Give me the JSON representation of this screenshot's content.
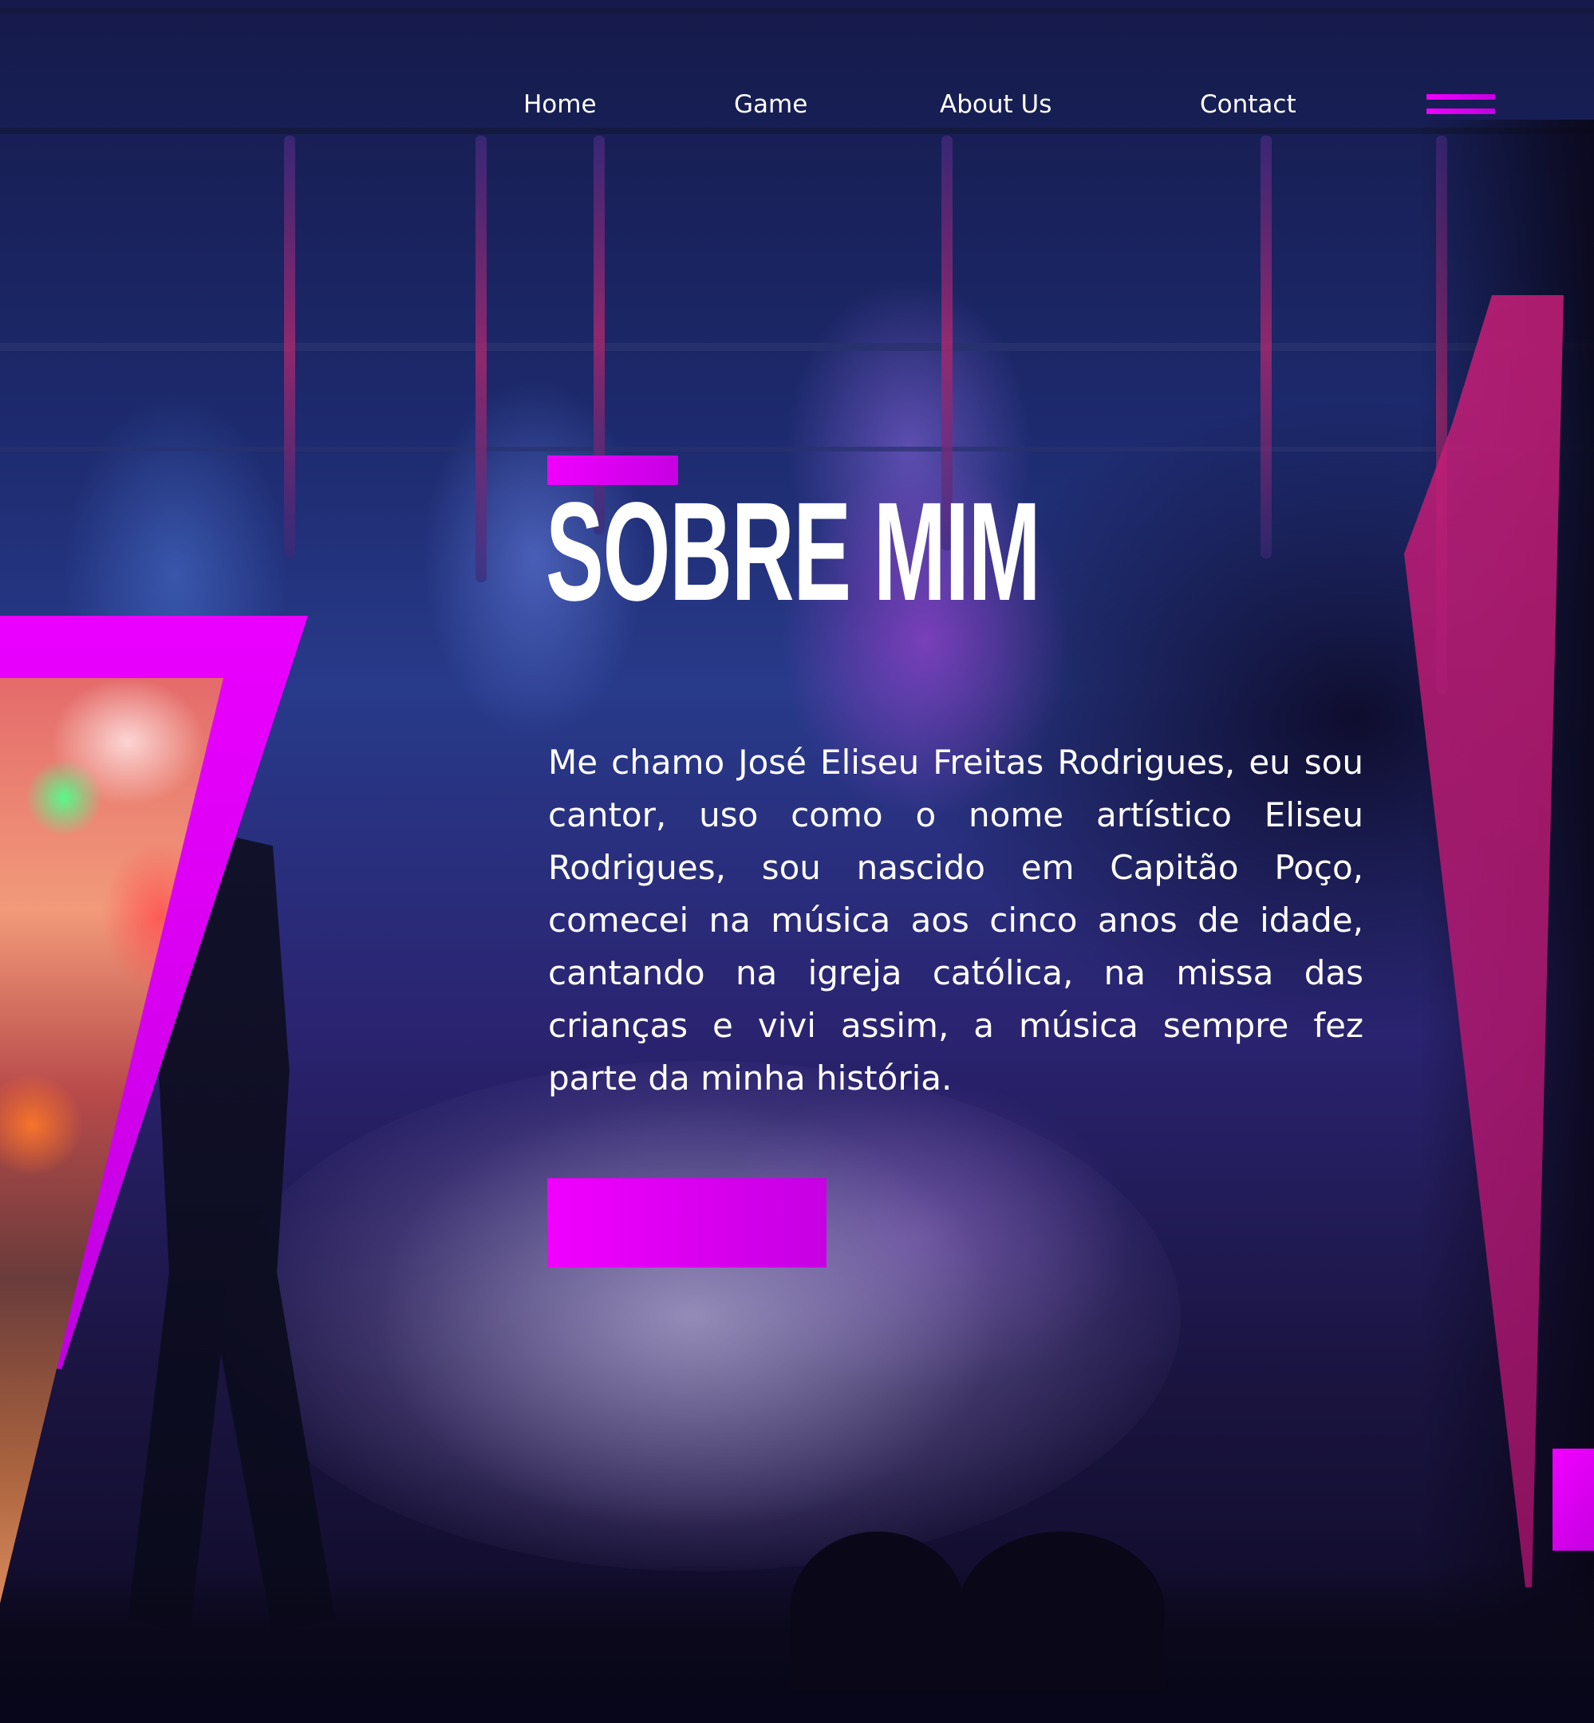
{
  "nav": {
    "items": [
      {
        "label": "Home"
      },
      {
        "label": "Game"
      },
      {
        "label": "About Us"
      },
      {
        "label": "Contact"
      }
    ],
    "menu_icon": "hamburger-menu-icon"
  },
  "about": {
    "title": "SOBRE MIM",
    "bio": "Me chamo José Eliseu Freitas Rodrigues, eu sou cantor, uso como o nome artístico Eliseu Rodrigues, sou nascido em Capitão Poço, comecei na música aos cinco anos de idade, cantando na igreja católica, na missa das crianças e vivi assim, a música sempre fez parte da minha história.",
    "button_label": ""
  },
  "colors": {
    "accent": "#f000ff",
    "accent_dark": "#c600e2",
    "text": "#ffffff",
    "background": "#1d2a6e"
  }
}
